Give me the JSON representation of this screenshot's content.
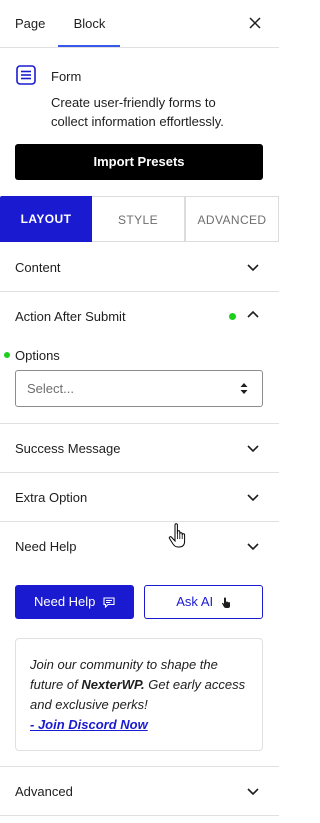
{
  "header": {
    "tabs": [
      "Page",
      "Block"
    ],
    "active_tab": "Block",
    "accent_color": "#3858e9"
  },
  "block": {
    "icon": "form-icon",
    "name": "Form",
    "description": "Create user-friendly forms to collect information effortlessly."
  },
  "import_button": {
    "label": "Import Presets"
  },
  "settings_tabs": {
    "items": [
      "LAYOUT",
      "STYLE",
      "ADVANCED"
    ],
    "active": "LAYOUT",
    "active_color": "#1a1ad0"
  },
  "panels": {
    "content": {
      "label": "Content",
      "expanded": false
    },
    "action_after_submit": {
      "label": "Action After Submit",
      "expanded": true,
      "indicator_color": "#1ccf1c"
    },
    "options": {
      "label": "Options",
      "placeholder": "Select..."
    },
    "success_message": {
      "label": "Success Message",
      "expanded": false
    },
    "extra_option": {
      "label": "Extra Option",
      "expanded": false
    },
    "need_help": {
      "label": "Need Help",
      "expanded": true
    },
    "advanced": {
      "label": "Advanced",
      "expanded": false
    }
  },
  "help": {
    "need_help_button": "Need Help",
    "ask_ai_button": "Ask AI",
    "community_text_1": "Join our community to shape the future of ",
    "community_brand": "NexterWP.",
    "community_text_2": " Get early access and exclusive perks!",
    "discord_link": "- Join Discord Now"
  }
}
